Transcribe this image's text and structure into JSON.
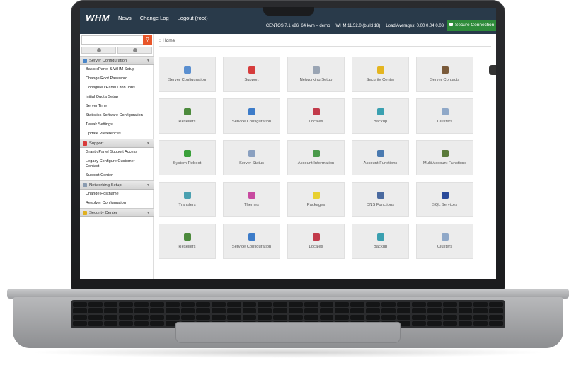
{
  "header": {
    "logo": "WHM",
    "nav": [
      "News",
      "Change Log",
      "Logout (root)"
    ],
    "sysinfo": [
      "CENTOS 7.1 x86_64 kvm – demo",
      "WHM 11.52.0 (build 18)",
      "Load Averages: 0.00 0.04 0.03"
    ],
    "secure_label": "Secure Connection"
  },
  "sidebar": {
    "categories": [
      {
        "label": "Server Configuration",
        "color": "#4a86c8",
        "items": [
          "Basic cPanel & WHM Setup",
          "Change Root Password",
          "Configure cPanel Cron Jobs",
          "Initial Quota Setup",
          "Server Time",
          "Statistics Software Configuration",
          "Tweak Settings",
          "Update Preferences"
        ]
      },
      {
        "label": "Support",
        "color": "#d93b3b",
        "items": [
          "Grant cPanel Support Access",
          "Legacy Configure Customer Contact",
          "Support Center"
        ]
      },
      {
        "label": "Networking Setup",
        "color": "#8a9bb0",
        "items": [
          "Change Hostname",
          "Resolver Configuration"
        ]
      },
      {
        "label": "Security Center",
        "color": "#e0b020",
        "items": []
      }
    ]
  },
  "breadcrumb": "Home",
  "tiles": [
    {
      "label": "Server Configuration",
      "color": "#5a8fd0"
    },
    {
      "label": "Support",
      "color": "#d63c3c"
    },
    {
      "label": "Networking Setup",
      "color": "#9aa5b4"
    },
    {
      "label": "Security Center",
      "color": "#e4b520"
    },
    {
      "label": "Server Contacts",
      "color": "#7a5a3a"
    },
    {
      "label": "Resellers",
      "color": "#4c8a3c"
    },
    {
      "label": "Service Configuration",
      "color": "#3d7cc9"
    },
    {
      "label": "Locales",
      "color": "#c23a4a"
    },
    {
      "label": "Backup",
      "color": "#3aa0b0"
    },
    {
      "label": "Clusters",
      "color": "#8fa8c8"
    },
    {
      "label": "System Reboot",
      "color": "#3aa03a"
    },
    {
      "label": "Server Status",
      "color": "#8aa0c0"
    },
    {
      "label": "Account Information",
      "color": "#4a9a4a"
    },
    {
      "label": "Account Functions",
      "color": "#4a7ab0"
    },
    {
      "label": "Multi Account Functions",
      "color": "#5a7a3a"
    },
    {
      "label": "Transfers",
      "color": "#4aa0b0"
    },
    {
      "label": "Themes",
      "color": "#c84aa0"
    },
    {
      "label": "Packages",
      "color": "#e8d030"
    },
    {
      "label": "DNS Functions",
      "color": "#4a6aa0"
    },
    {
      "label": "SQL Services",
      "color": "#2a4a9a"
    },
    {
      "label": "Resellers",
      "color": "#4c8a3c"
    },
    {
      "label": "Service Configuration",
      "color": "#3d7cc9"
    },
    {
      "label": "Locales",
      "color": "#c23a4a"
    },
    {
      "label": "Backup",
      "color": "#3aa0b0"
    },
    {
      "label": "Clusters",
      "color": "#8fa8c8"
    }
  ]
}
